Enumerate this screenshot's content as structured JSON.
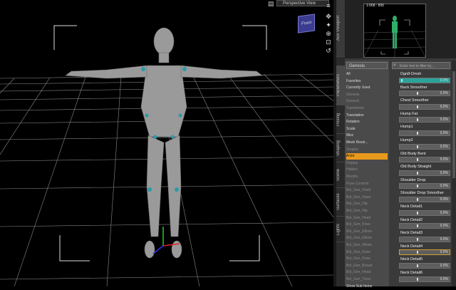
{
  "viewport": {
    "view_title": "Perspective View",
    "view_cube_label": "Front"
  },
  "aux": {
    "tab_label": "Aux Viewport",
    "label": "1:068 : 895"
  },
  "side_tabs": [
    "Parameters",
    "Posing",
    "Shaping",
    "Scene",
    "Surfaces",
    "Lights"
  ],
  "tree": {
    "select_value": "Genesis",
    "rows": [
      {
        "label": "All",
        "style": "normal"
      },
      {
        "label": "Favorites",
        "style": "normal"
      },
      {
        "label": "Currently Used",
        "style": "normal"
      },
      {
        "label": "Genesis",
        "style": "dim"
      },
      {
        "label": "General",
        "style": "dim"
      },
      {
        "label": "Transforms",
        "style": "dim"
      },
      {
        "label": "Translation",
        "style": "normal"
      },
      {
        "label": "Rotation",
        "style": "normal"
      },
      {
        "label": "Scale",
        "style": "normal"
      },
      {
        "label": "Misc",
        "style": "normal"
      },
      {
        "label": "Mesh Resol...",
        "style": "normal"
      },
      {
        "label": "Shapes",
        "style": "dim"
      },
      {
        "label": "Actor",
        "style": "selected"
      },
      {
        "label": "Display",
        "style": "dim"
      },
      {
        "label": "Hidden",
        "style": "dim"
      },
      {
        "label": "Morphs",
        "style": "dim"
      },
      {
        "label": "Pose Controls",
        "style": "dim"
      },
      {
        "label": "Bol_Gen_Hand",
        "style": "dim"
      },
      {
        "label": "Bol_Gen_Hand",
        "style": "dim"
      },
      {
        "label": "Bol_Gen_Hip",
        "style": "dim"
      },
      {
        "label": "Bol_Gen_Hip",
        "style": "dim"
      },
      {
        "label": "Bol_Gen_Head",
        "style": "dim"
      },
      {
        "label": "Bol_Gen_Knee",
        "style": "dim"
      },
      {
        "label": "Bol_Gen_Elbow",
        "style": "dim"
      },
      {
        "label": "Bol_Gen_Elbow",
        "style": "dim"
      },
      {
        "label": "Bol_Gen_Wrists",
        "style": "dim"
      },
      {
        "label": "Bol_Gen_Knee",
        "style": "dim"
      },
      {
        "label": "Bol_Gen_Knee",
        "style": "dim"
      },
      {
        "label": "Bol_Gen_Breast",
        "style": "dim"
      },
      {
        "label": "Bol_Gen_Head",
        "style": "dim"
      },
      {
        "label": "Bol_Gen_Torso",
        "style": "dim"
      },
      {
        "label": "Show Sub Items",
        "style": "normal"
      }
    ]
  },
  "filter_placeholder": "Enter text to filter by...",
  "sliders": [
    {
      "label": "Dgn8-Dmsh",
      "value": "0.0%",
      "pos": 0.0
    },
    {
      "label": "Back Smoother",
      "value": "0.0%",
      "pos": 0.5
    },
    {
      "label": "Chest Smoother",
      "value": "0.0%",
      "pos": 0.5
    },
    {
      "label": "Hump Fat",
      "value": "0.0%",
      "pos": 0.5
    },
    {
      "label": "Hump1",
      "value": "0.0%",
      "pos": 0.5
    },
    {
      "label": "Hump2",
      "value": "0.0%",
      "pos": 0.5
    },
    {
      "label": "Old Body Bent",
      "value": "0.0%",
      "pos": 0.5
    },
    {
      "label": "Old Body Straight",
      "value": "0.0%",
      "pos": 0.5
    },
    {
      "label": "Shoulder Drop",
      "value": "0.0%",
      "pos": 0.5
    },
    {
      "label": "Shoulder Drop Smoother",
      "value": "0.0%",
      "pos": 0.5
    },
    {
      "label": "Neck Detail1",
      "value": "0.0%",
      "pos": 0.5
    },
    {
      "label": "Neck Detail2",
      "value": "0.0%",
      "pos": 0.5
    },
    {
      "label": "Neck Detail3",
      "value": "0.0%",
      "pos": 0.5
    },
    {
      "label": "Neck Detail4",
      "value": "0.0%",
      "pos": 0.5
    },
    {
      "label": "Neck Detail5",
      "value": "0.0%",
      "pos": 0.5
    },
    {
      "label": "Neck Detail6",
      "value": "0.0%",
      "pos": 0.5
    }
  ],
  "bottom_tab": "Tips",
  "colors": {
    "selection": "#e89a1c",
    "accent": "#2aa39a",
    "panel": "#3a3a3a"
  }
}
